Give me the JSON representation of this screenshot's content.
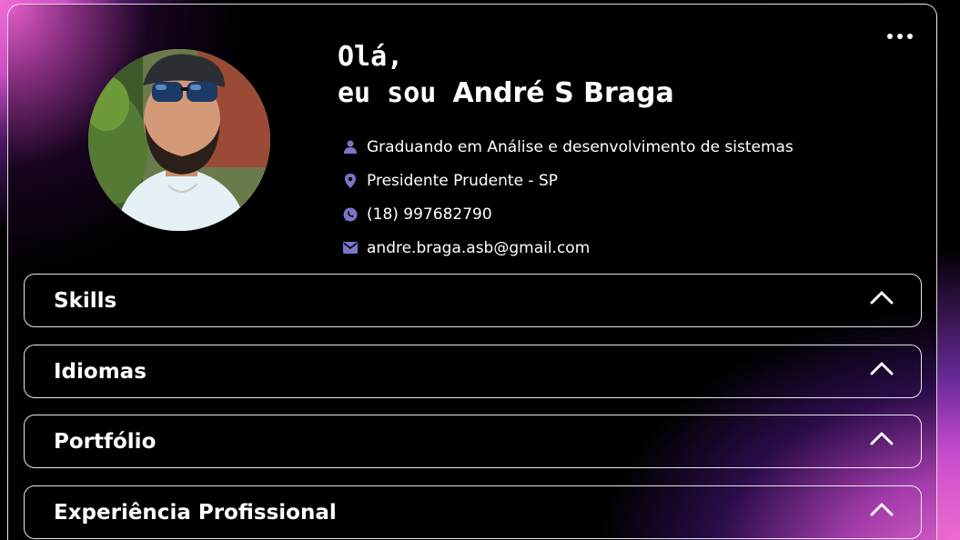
{
  "header": {
    "greeting_line1": "Olá,",
    "greeting_prefix": "eu sou ",
    "name": "André S Braga"
  },
  "info": [
    {
      "icon": "user-icon",
      "text": "Graduando em Análise e desenvolvimento de sistemas"
    },
    {
      "icon": "location-pin-icon",
      "text": "Presidente Prudente - SP"
    },
    {
      "icon": "whatsapp-icon",
      "text": "(18) 997682790"
    },
    {
      "icon": "mail-icon",
      "text": "andre.braga.asb@gmail.com"
    }
  ],
  "sections": [
    {
      "title": "Skills",
      "state": "expanded-indicator-up"
    },
    {
      "title": "Idiomas",
      "state": "expanded-indicator-up"
    },
    {
      "title": "Portfólio",
      "state": "expanded-indicator-up"
    },
    {
      "title": "Experiência Profissional",
      "state": "expanded-indicator-up"
    }
  ],
  "colors": {
    "accent_pink": "#f06bd0",
    "accent_purple": "#6a2a9a",
    "icon_color": "#7b75c9",
    "background": "#000000",
    "text": "#ffffff"
  }
}
